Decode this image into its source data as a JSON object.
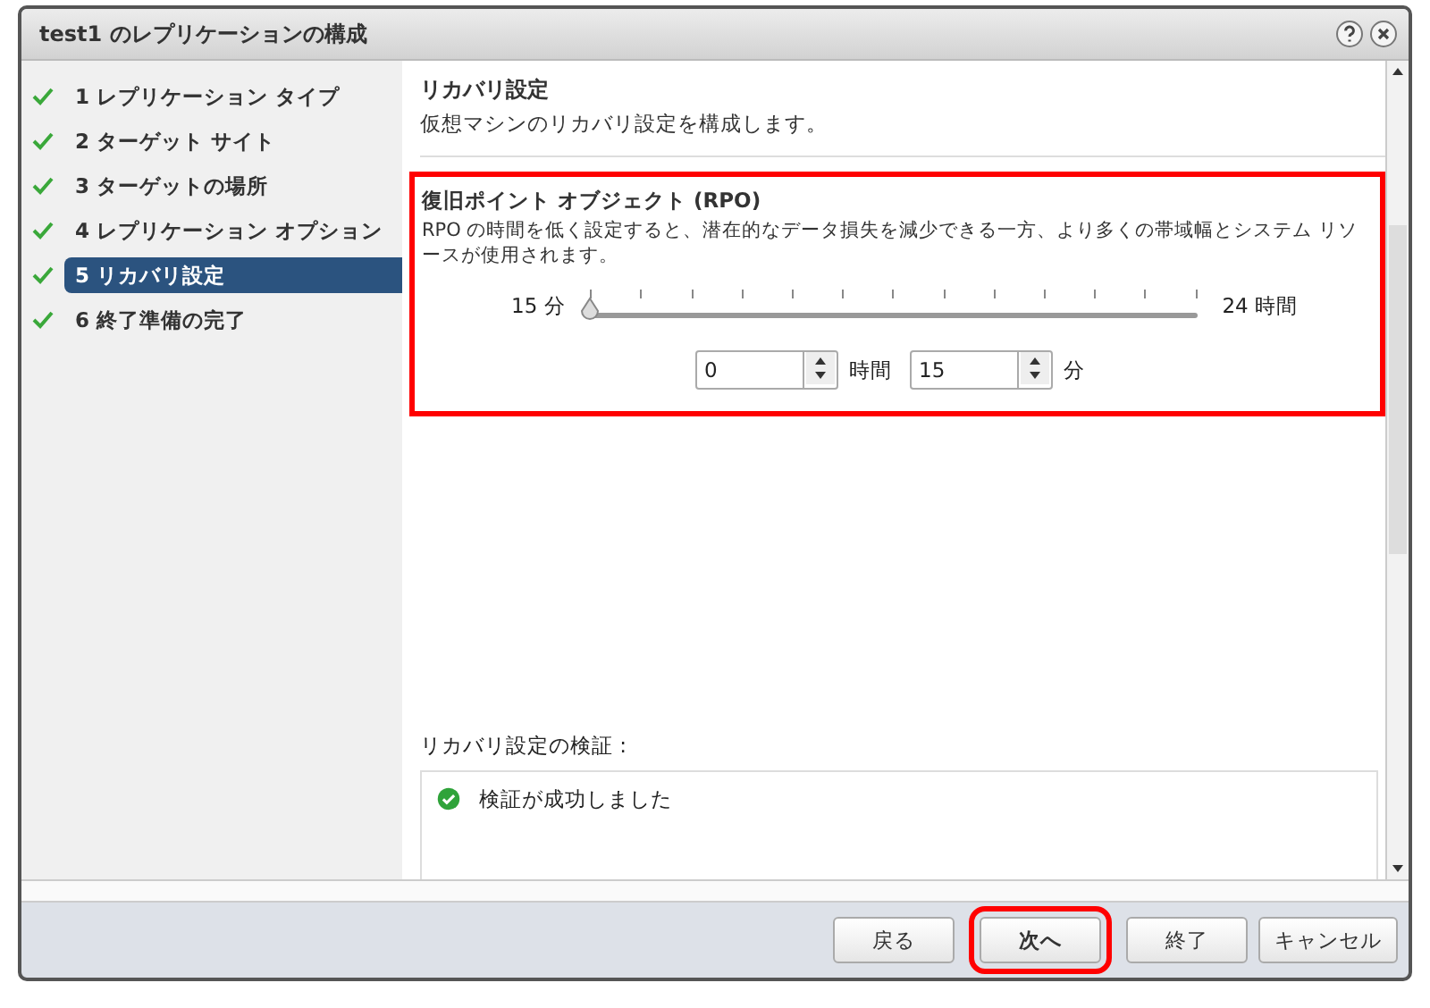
{
  "window": {
    "title": "test1 のレプリケーションの構成"
  },
  "steps": [
    {
      "number": "1",
      "label": "レプリケーション タイプ",
      "done": true,
      "selected": false
    },
    {
      "number": "2",
      "label": "ターゲット サイト",
      "done": true,
      "selected": false
    },
    {
      "number": "3",
      "label": "ターゲットの場所",
      "done": true,
      "selected": false
    },
    {
      "number": "4",
      "label": "レプリケーション オプション",
      "done": true,
      "selected": false
    },
    {
      "number": "5",
      "label": "リカバリ設定",
      "done": true,
      "selected": true
    },
    {
      "number": "6",
      "label": "終了準備の完了",
      "done": true,
      "selected": false
    }
  ],
  "page": {
    "title": "リカバリ設定",
    "subtitle": "仮想マシンのリカバリ設定を構成します。"
  },
  "rpo": {
    "highlighted": true,
    "title": "復旧ポイント オブジェクト (RPO)",
    "description": "RPO の時間を低く設定すると、潜在的なデータ損失を減少できる一方、より多くの帯域幅とシステム リソースが使用されます。",
    "slider": {
      "min_label": "15 分",
      "max_label": "24 時間",
      "level": 0
    },
    "spinners": [
      {
        "value": "0",
        "unit": "時間"
      },
      {
        "value": "15",
        "unit": "分"
      }
    ]
  },
  "validation": {
    "label": "リカバリ設定の検証 :",
    "ok": true,
    "message": "検証が成功しました"
  },
  "buttons": [
    {
      "label": "戻る",
      "highlighted": false
    },
    {
      "label": "次へ",
      "highlighted": true
    },
    {
      "label": "終了",
      "highlighted": false
    },
    {
      "label": "キャンセル",
      "highlighted": false
    }
  ]
}
